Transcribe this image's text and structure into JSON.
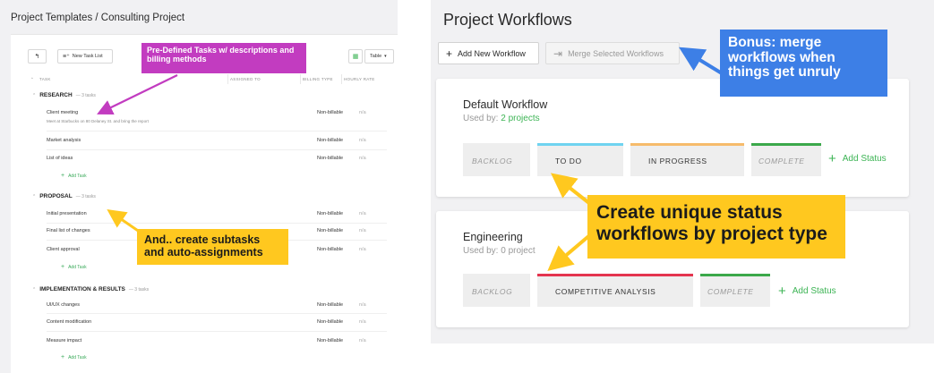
{
  "left": {
    "breadcrumb": "Project Templates / Consulting Project",
    "toolbar": {
      "new_task_list": "New Task List",
      "view": "Table"
    },
    "columns": [
      "TASK",
      "ASSIGNED TO",
      "BILLING TYPE",
      "HOURLY RATE"
    ],
    "sections": [
      {
        "title": "RESEARCH",
        "count": "— 3 tasks",
        "tasks": [
          {
            "name": "Client meeting",
            "desc": "Meet at Starbucks on 80 Delaney St. and bring the report",
            "billing": "Non-billable",
            "rate": "n/a"
          },
          {
            "name": "Market analysis",
            "billing": "Non-billable",
            "rate": "n/a"
          },
          {
            "name": "List of ideas",
            "billing": "Non-billable",
            "rate": "n/a"
          }
        ]
      },
      {
        "title": "PROPOSAL",
        "count": "— 3 tasks",
        "tasks": [
          {
            "name": "Initial presentation",
            "billing": "Non-billable",
            "rate": "n/a"
          },
          {
            "name": "Final list of changes",
            "billing": "Non-billable",
            "rate": "n/a"
          },
          {
            "name": "Client approval",
            "billing": "Non-billable",
            "rate": "n/a"
          }
        ]
      },
      {
        "title": "IMPLEMENTATION & RESULTS",
        "count": "— 3 tasks",
        "tasks": [
          {
            "name": "UI/UX changes",
            "billing": "Non-billable",
            "rate": "n/a"
          },
          {
            "name": "Content modification",
            "billing": "Non-billable",
            "rate": "n/a"
          },
          {
            "name": "Measure impact",
            "billing": "Non-billable",
            "rate": "n/a"
          }
        ]
      }
    ],
    "add_task": "Add Task"
  },
  "callouts": {
    "pink": "Pre-Defined Tasks w/ descriptions and billing methods",
    "yellow_small": "And.. create subtasks and auto-assignments",
    "blue": "Bonus: merge workflows when things get unruly",
    "yellow_big": "Create unique status workflows by project type"
  },
  "right": {
    "title": "Project Workflows",
    "add_workflow": "Add New Workflow",
    "merge_workflows": "Merge Selected Workflows",
    "add_status": "Add Status",
    "workflows": [
      {
        "name": "Default Workflow",
        "used_by_prefix": "Used by:",
        "used_by_count": "2 projects",
        "statuses": [
          {
            "label": "BACKLOG",
            "color": "#eeeeee"
          },
          {
            "label": "TO DO",
            "color": "#6fd3f0"
          },
          {
            "label": "IN PROGRESS",
            "color": "#f6bb6b"
          },
          {
            "label": "COMPLETE",
            "color": "#3ba84a"
          }
        ]
      },
      {
        "name": "Engineering",
        "used_by_prefix": "Used by:",
        "used_by_count": "0 project",
        "statuses": [
          {
            "label": "BACKLOG",
            "color": "#eeeeee"
          },
          {
            "label": "COMPETITIVE ANALYSIS",
            "color": "#e4344f"
          },
          {
            "label": "COMPLETE",
            "color": "#3ba84a"
          }
        ]
      }
    ]
  },
  "colors": {
    "green": "#3db455",
    "pink": "#c23cc0",
    "yellow": "#ffc81f",
    "blue": "#3d7fe6"
  }
}
